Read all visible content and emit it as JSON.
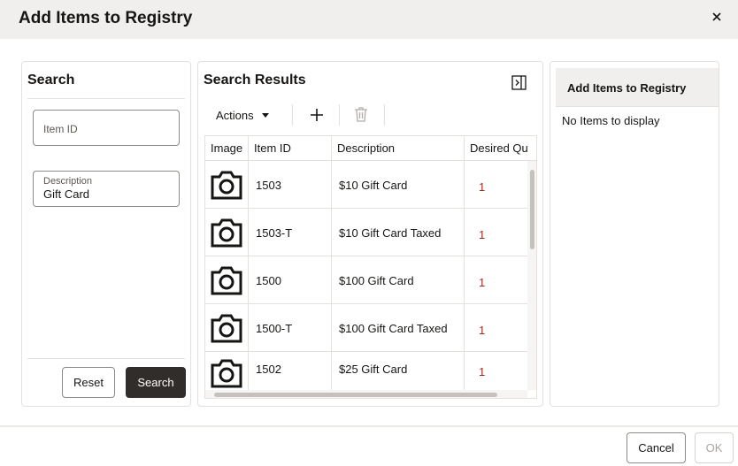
{
  "dialog": {
    "title": "Add Items to Registry",
    "close_icon": "close-icon"
  },
  "search": {
    "title": "Search",
    "item_id": {
      "placeholder": "Item ID",
      "value": ""
    },
    "description": {
      "label": "Description",
      "value": "Gift Card"
    },
    "reset_label": "Reset",
    "search_label": "Search"
  },
  "results": {
    "title": "Search Results",
    "toolbar": {
      "actions_label": "Actions",
      "add_icon": "plus-icon",
      "delete_icon": "trash-icon"
    },
    "columns": [
      "Image",
      "Item ID",
      "Description",
      "Desired Qu"
    ],
    "rows": [
      {
        "image": "camera-icon",
        "item_id": "1503",
        "description": "$10 Gift Card",
        "qty": "1"
      },
      {
        "image": "camera-icon",
        "item_id": "1503-T",
        "description": "$10 Gift Card Taxed",
        "qty": "1"
      },
      {
        "image": "camera-icon",
        "item_id": "1500",
        "description": "$100 Gift Card",
        "qty": "1"
      },
      {
        "image": "camera-icon",
        "item_id": "1500-T",
        "description": "$100 Gift Card Taxed",
        "qty": "1"
      },
      {
        "image": "camera-icon",
        "item_id": "1502",
        "description": "$25 Gift Card",
        "qty": "1"
      }
    ]
  },
  "registry": {
    "title": "Add Items to Registry",
    "empty_text": "No Items to display"
  },
  "footer": {
    "cancel_label": "Cancel",
    "ok_label": "OK"
  },
  "colors": {
    "header_bg": "#f1efed",
    "primary_button": "#312d2a",
    "qty_text": "#a22b1d",
    "border": "#e4e1dd"
  }
}
